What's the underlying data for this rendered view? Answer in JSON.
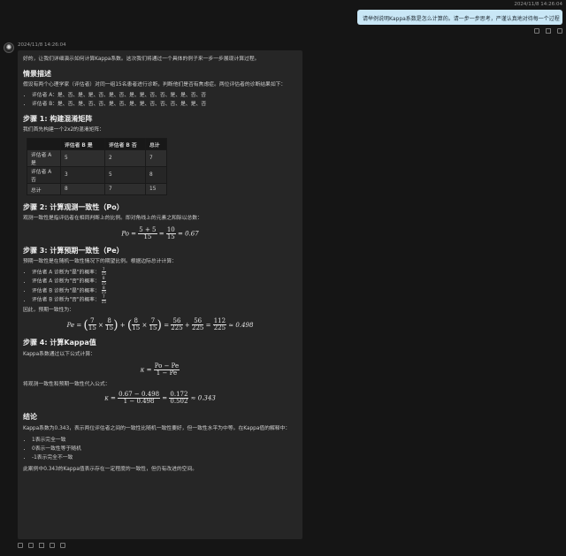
{
  "user": {
    "timestamp": "2024/11/8 14:26:04",
    "message": "请举例说明Kappa系数是怎么计算的。请一步一步思考，严谨认真地对待每一个过程"
  },
  "assistant": {
    "avatar_icon": "openai-logo-icon",
    "timestamp": "2024/11/8 14:26:04",
    "intro": "好的，让我们详细演示如何计算Kappa系数。这次我们将通过一个具体的例子来一步一步展现计算过程。",
    "sec1_title": "情景描述",
    "sec1_text": "假设有两个心理学家（评估者）对同一组15名患者进行诊断，判断他们是否有焦虑症。两位评估者的诊断结果如下：",
    "rater_a": "评估者 A：是、否、是、是、否、是、否、是、是、否、否、是、是、否、否",
    "rater_b": "评估者 B：是、否、是、否、否、是、否、是、是、否、否、否、是、是、否",
    "step1_title": "步骤 1: 构建混淆矩阵",
    "step1_text": "我们首先构建一个2x2的混淆矩阵：",
    "table": {
      "headers": [
        "",
        "评估者 B 是",
        "评估者 B 否",
        "总计"
      ],
      "rows": [
        [
          "评估者 A 是",
          "5",
          "2",
          "7"
        ],
        [
          "评估者 A 否",
          "3",
          "5",
          "8"
        ],
        [
          "总计",
          "8",
          "7",
          "15"
        ]
      ]
    },
    "step2_title": "步骤 2: 计算观测一致性（Po）",
    "step2_text": "观测一致性是指评估者在相同判断上的比例。即对角线上的元素之和除以总数：",
    "step3_title": "步骤 3: 计算预期一致性（Pe）",
    "step3_text": "预期一致性是在随机一致性情况下的期望比例。根据边际总计计算：",
    "step3_items": [
      "评估者 A 诊断为\"是\"的概率：",
      "评估者 A 诊断为\"否\"的概率：",
      "评估者 B 诊断为\"是\"的概率：",
      "评估者 B 诊断为\"否\"的概率："
    ],
    "step3_fracs": [
      [
        "7",
        "15"
      ],
      [
        "8",
        "15"
      ],
      [
        "8",
        "15"
      ],
      [
        "7",
        "15"
      ]
    ],
    "step3_thus": "因此，预期一致性为：",
    "step4_title": "步骤 4: 计算Kappa值",
    "step4_text": "Kappa系数通过以下公式计算：",
    "step4_sub": "将观测一致性和预期一致性代入公式：",
    "conclusion_title": "结论",
    "conclusion_text": "Kappa系数为0.343，表示两位评估者之间的一致性比随机一致性要好，但一致性水平为中等。在Kappa值的解释中：",
    "conclusion_items": [
      "1表示完全一致",
      "0表示一致性等于随机",
      "-1表示完全不一致"
    ],
    "final_text": "此案例中0.343的Kappa值表示存在一定程度的一致性，但仍有改进的空间。"
  }
}
